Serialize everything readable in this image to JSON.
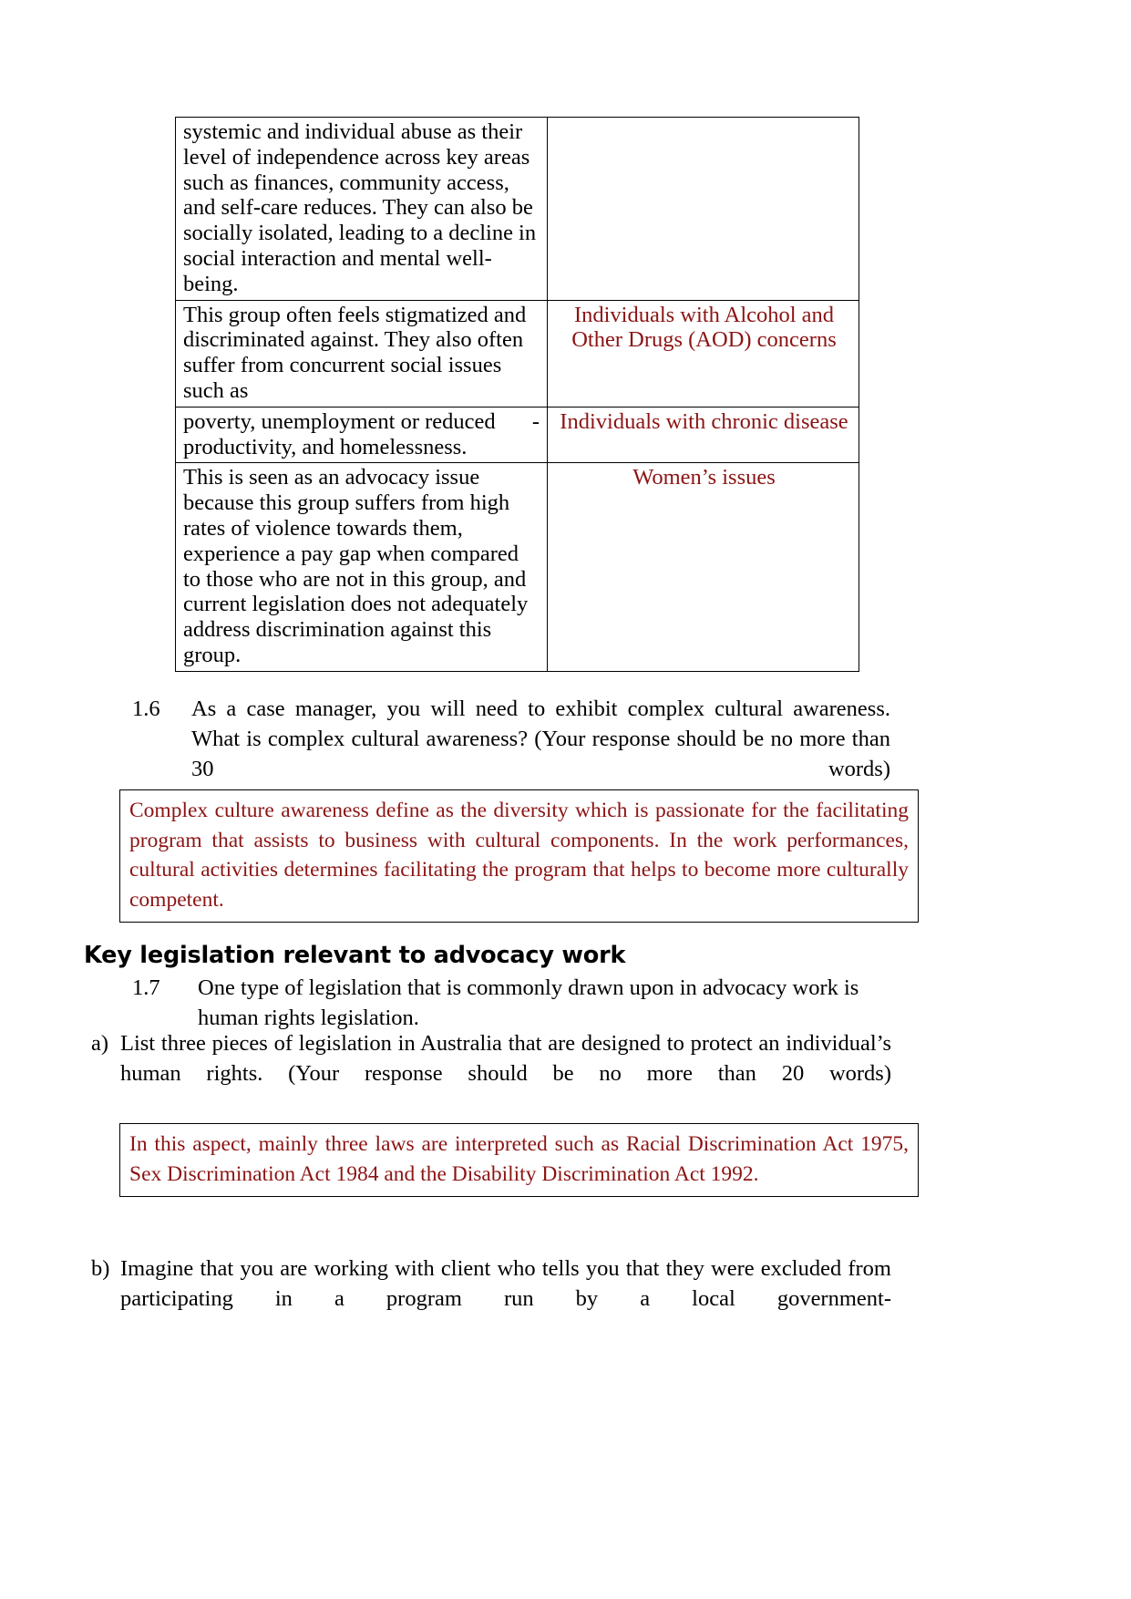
{
  "colors": {
    "answer_red": "#8c1414",
    "text_black": "#000000",
    "border": "#000000"
  },
  "table": {
    "rows": [
      {
        "left": "systemic and individual abuse as their level of independence across key areas such as finances, community access, and self-care reduces. They can also be socially isolated, leading to a decline in social interaction and mental well-being.",
        "right": ""
      },
      {
        "left": "This group often feels stigmatized and discriminated against. They also often suffer from concurrent social issues such as",
        "right": "Individuals with Alcohol and Other Drugs (AOD) concerns"
      },
      {
        "left": "poverty, unemployment or reduced productivity, and homelessness.",
        "left_dash": "-",
        "right": "Individuals with chronic disease"
      },
      {
        "left": "This is seen as an advocacy issue because this group suffers from high rates of violence towards them, experience a pay gap when compared to those who are not in this group, and current legislation does not adequately address discrimination against this group.",
        "right": "Women’s issues"
      }
    ]
  },
  "question_1_6": {
    "number": "1.6",
    "text": "As a case manager, you will need to exhibit complex cultural awareness. What is complex cultural awareness? (Your response should be no more than 30 words)"
  },
  "answer_1_6": {
    "text": "Complex culture awareness define as the diversity which is passionate for the facilitating program that assists to business with cultural components. In the work performances, cultural activities determines facilitating the program that helps to become more culturally competent."
  },
  "section_heading": {
    "text": "Key legislation relevant to advocacy work"
  },
  "question_1_7": {
    "number": "1.7",
    "text": "One type of legislation that is commonly drawn upon in advocacy work is human rights legislation."
  },
  "item_a": {
    "marker": "a)",
    "text": "List three pieces of legislation in Australia that are designed to protect an individual’s human rights. (Your response should be no more than 20 words)"
  },
  "answer_a": {
    "text": "In this aspect, mainly three laws are interpreted such as Racial Discrimination Act 1975, Sex Discrimination Act 1984 and the Disability Discrimination Act 1992."
  },
  "item_b": {
    "marker": "b)",
    "text": "Imagine that you are working with client who tells you that they were excluded from participating in a program run by a local government-"
  }
}
